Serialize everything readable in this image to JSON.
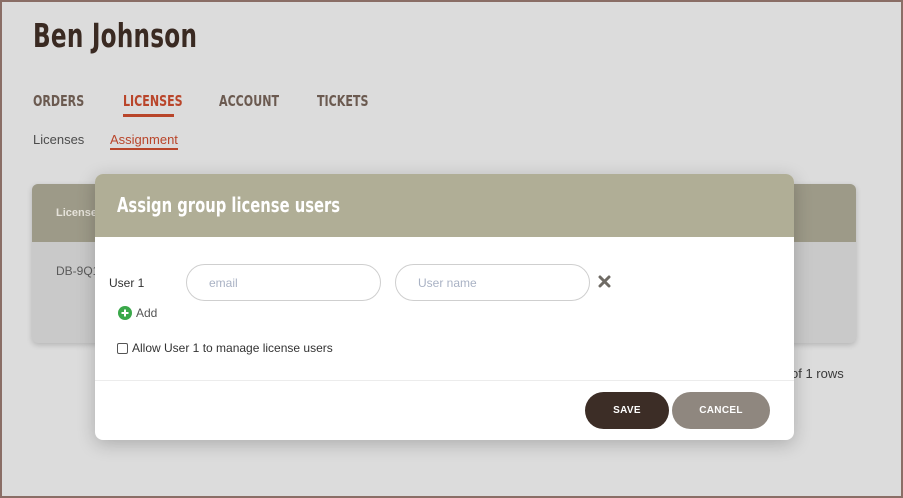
{
  "user": {
    "name": "Ben Johnson"
  },
  "tabs": [
    {
      "label": "ORDERS",
      "active": false
    },
    {
      "label": "LICENSES",
      "active": true
    },
    {
      "label": "ACCOUNT",
      "active": false
    },
    {
      "label": "TICKETS",
      "active": false
    }
  ],
  "subnav": [
    {
      "label": "Licenses",
      "active": false
    },
    {
      "label": "Assignment",
      "active": true
    }
  ],
  "background_table": {
    "column_header": "License",
    "cell": "DB-9Q1",
    "rows_text": "of 1 rows"
  },
  "modal": {
    "title": "Assign group license users",
    "user_label": "User 1",
    "email_placeholder": "email",
    "email_value": "",
    "username_placeholder": "User name",
    "username_value": "",
    "remove_icon": "close-x-icon",
    "add_label": "Add",
    "add_icon": "plus-circle-icon",
    "checkbox_label": "Allow User 1 to manage license users",
    "checkbox_checked": false,
    "save_label": "SAVE",
    "cancel_label": "CANCEL"
  },
  "colors": {
    "accent": "#b9452a",
    "header_band": "#b0ae96",
    "save_button": "#3c2d26",
    "cancel_button": "#8f877f",
    "add_icon": "#3aa84a"
  }
}
